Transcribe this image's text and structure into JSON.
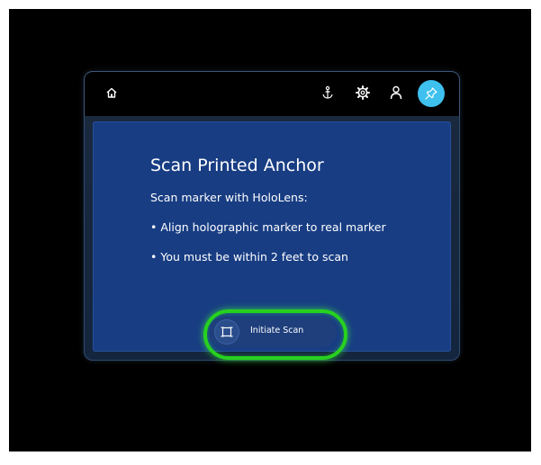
{
  "toolbar": {
    "icons": [
      "home-icon",
      "anchor-icon",
      "gear-icon",
      "person-icon",
      "pin-icon"
    ],
    "pin_button_color": "#3ec1ee"
  },
  "card": {
    "title": "Scan Printed Anchor",
    "subtitle": "Scan marker with HoloLens:",
    "bullets": [
      "• Align holographic marker to real marker",
      "• You must be within 2 feet to scan"
    ],
    "background_color": "#183d83"
  },
  "scan_button": {
    "label": "Initiate Scan",
    "icon": "scan-frame-icon",
    "highlight_color": "#27d21f"
  }
}
